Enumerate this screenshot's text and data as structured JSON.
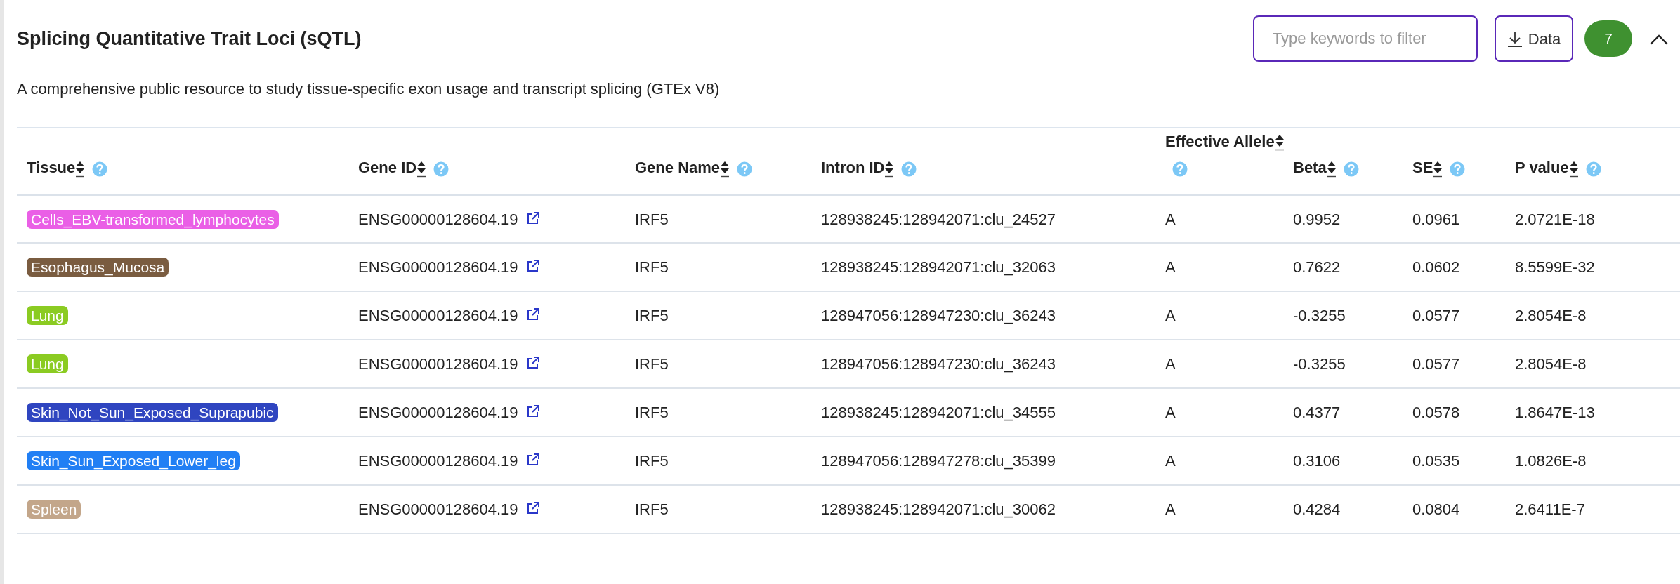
{
  "header": {
    "title": "Splicing Quantitative Trait Loci (sQTL)",
    "filter": {
      "placeholder": "Type keywords to filter"
    },
    "download_button": "Data",
    "count": "7",
    "collapse": {
      "expanded": true
    }
  },
  "description": "A comprehensive public resource to study tissue-specific exon usage and transcript splicing (GTEx V8)",
  "table": {
    "columns": [
      "Tissue",
      "Gene ID",
      "Gene Name",
      "Intron ID",
      "Effective Allele",
      "Beta",
      "SE",
      "P value"
    ],
    "rows": [
      {
        "tissue": "Cells_EBV-transformed_lymphocytes",
        "color": "#ea5fe6",
        "gene_id": "ENSG00000128604.19",
        "gene_name": "IRF5",
        "intron_id": "128938245:128942071:clu_24527",
        "allele": "A",
        "beta": "0.9952",
        "se": "0.0961",
        "p_value": "2.0721E-18"
      },
      {
        "tissue": "Esophagus_Mucosa",
        "color": "#7a5c40",
        "gene_id": "ENSG00000128604.19",
        "gene_name": "IRF5",
        "intron_id": "128938245:128942071:clu_32063",
        "allele": "A",
        "beta": "0.7622",
        "se": "0.0602",
        "p_value": "8.5599E-32"
      },
      {
        "tissue": "Lung",
        "color": "#8bcb22",
        "gene_id": "ENSG00000128604.19",
        "gene_name": "IRF5",
        "intron_id": "128947056:128947230:clu_36243",
        "allele": "A",
        "beta": "-0.3255",
        "se": "0.0577",
        "p_value": "2.8054E-8"
      },
      {
        "tissue": "Lung",
        "color": "#8bcb22",
        "gene_id": "ENSG00000128604.19",
        "gene_name": "IRF5",
        "intron_id": "128947056:128947230:clu_36243",
        "allele": "A",
        "beta": "-0.3255",
        "se": "0.0577",
        "p_value": "2.8054E-8"
      },
      {
        "tissue": "Skin_Not_Sun_Exposed_Suprapubic",
        "color": "#2f45c0",
        "gene_id": "ENSG00000128604.19",
        "gene_name": "IRF5",
        "intron_id": "128938245:128942071:clu_34555",
        "allele": "A",
        "beta": "0.4377",
        "se": "0.0578",
        "p_value": "1.8647E-13"
      },
      {
        "tissue": "Skin_Sun_Exposed_Lower_leg",
        "color": "#217ff4",
        "gene_id": "ENSG00000128604.19",
        "gene_name": "IRF5",
        "intron_id": "128947056:128947278:clu_35399",
        "allele": "A",
        "beta": "0.3106",
        "se": "0.0535",
        "p_value": "1.0826E-8"
      },
      {
        "tissue": "Spleen",
        "color": "#c3a68a",
        "gene_id": "ENSG00000128604.19",
        "gene_name": "IRF5",
        "intron_id": "128938245:128942071:clu_30062",
        "allele": "A",
        "beta": "0.4284",
        "se": "0.0804",
        "p_value": "2.6411E-7"
      }
    ]
  }
}
